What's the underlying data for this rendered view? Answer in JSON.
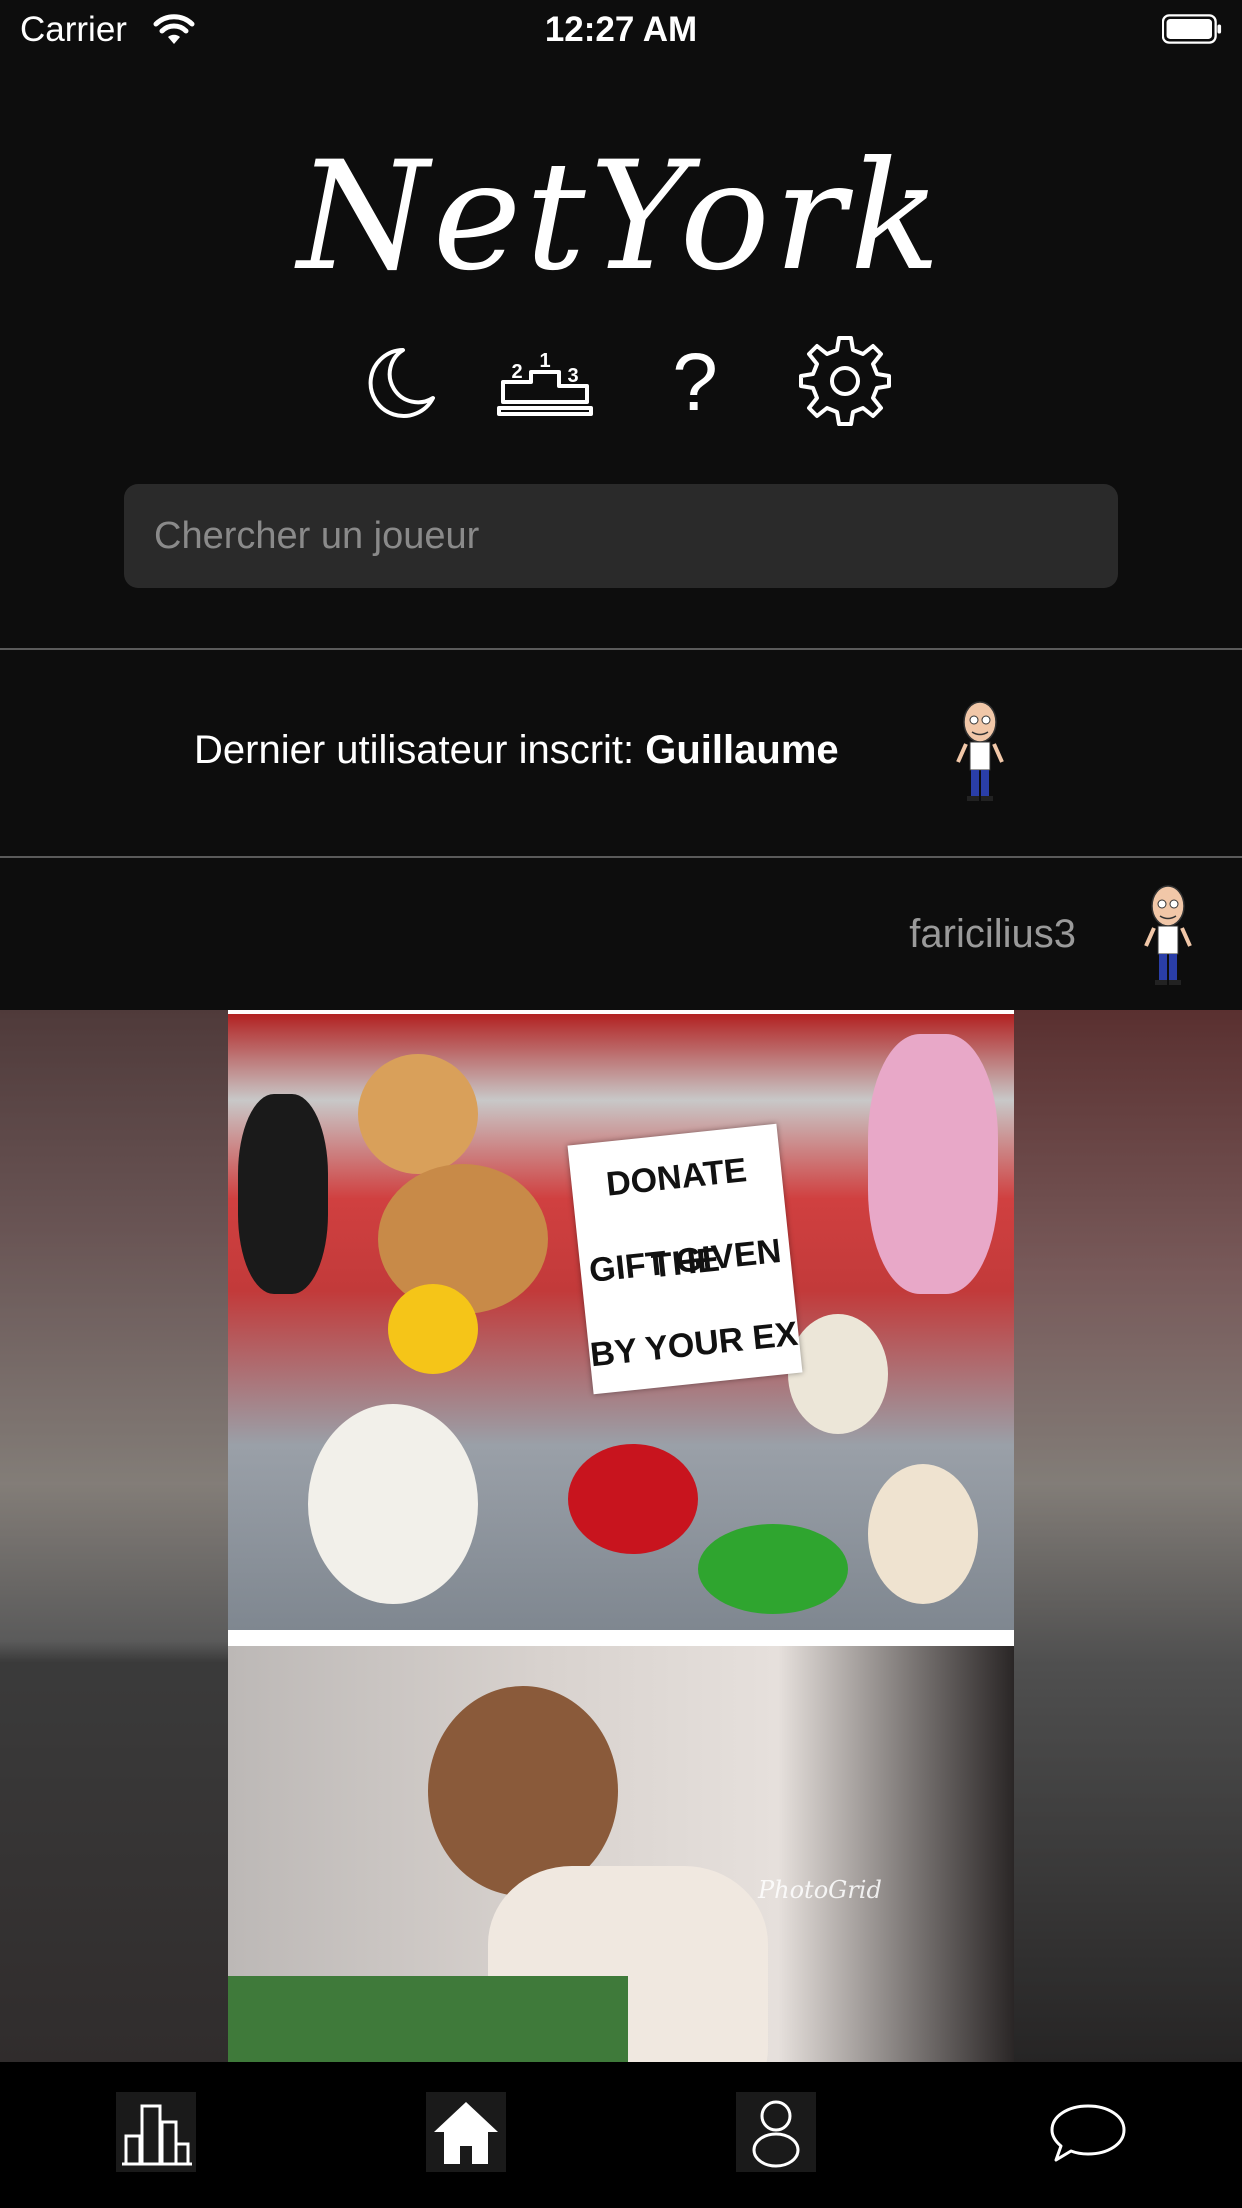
{
  "status_bar": {
    "carrier": "Carrier",
    "time": "12:27 AM"
  },
  "app": {
    "title": "NetYork"
  },
  "toolbar_icons": [
    "moon-icon",
    "podium-icon",
    "help-icon",
    "gear-icon"
  ],
  "podium_labels": [
    "2",
    "1",
    "3"
  ],
  "help_glyph": "?",
  "search": {
    "placeholder": "Chercher un joueur",
    "value": ""
  },
  "last_registered": {
    "label": "Dernier utilisateur inscrit: ",
    "username": "Guillaume"
  },
  "post": {
    "author": "faricilius3",
    "image_text": {
      "sign_lines": [
        "DONATE THE",
        "GIFT GIVEN",
        "BY YOUR EX"
      ],
      "watermark": "PhotoGrid"
    }
  },
  "tab_bar": {
    "items": [
      "city-icon",
      "home-icon",
      "profile-icon",
      "chat-icon"
    ],
    "active": "home-icon"
  },
  "colors": {
    "background": "#0d0d0d",
    "search_bg": "#2a2a2a",
    "divider": "#5a5a5a",
    "muted_text": "#9a9a9a",
    "tab_bar": "#000000"
  }
}
